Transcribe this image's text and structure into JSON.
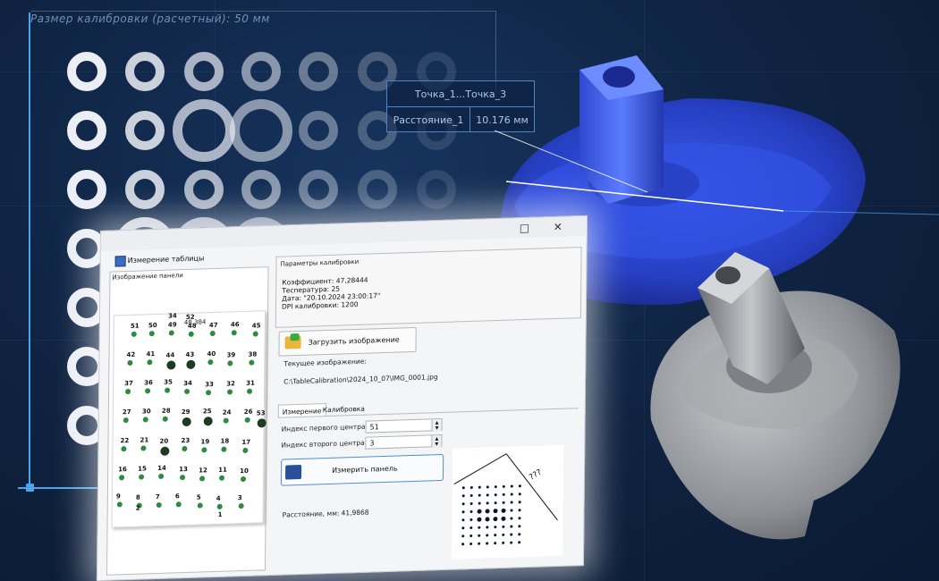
{
  "background": {
    "calibration_caption": "Размер калибровки (расчетный): 50 мм",
    "accent_color": "#4aa6e8"
  },
  "measurement_overlay": {
    "header": "Точка_1...Точка_3",
    "label": "Расстояние_1",
    "value": "10.176 мм"
  },
  "window": {
    "title": "Измерение таблицы",
    "controls": {
      "maximize": "□",
      "close": "✕"
    },
    "left_group": {
      "label": "Изображение панели",
      "overlay_value": "48.384",
      "dot_labels": [
        "34",
        "52",
        "51",
        "50",
        "49",
        "48",
        "47",
        "46",
        "45",
        "42",
        "41",
        "44",
        "43",
        "40",
        "39",
        "38",
        "37",
        "36",
        "35",
        "34",
        "33",
        "32",
        "31",
        "27",
        "30",
        "28",
        "29",
        "25",
        "24",
        "26",
        "53",
        "22",
        "21",
        "20",
        "23",
        "19",
        "18",
        "17",
        "16",
        "15",
        "14",
        "13",
        "12",
        "11",
        "10",
        "9",
        "8",
        "7",
        "6",
        "5",
        "4",
        "3",
        "2",
        "1"
      ]
    },
    "calibration": {
      "label": "Параметры калибровки",
      "lines": [
        "Коэффициент: 47,28444",
        "Теспература: 25",
        "Дата: \"20.10.2024 23:00:17\"",
        "DPI калибровки: 1200"
      ]
    },
    "load_button": "Загрузить изображение",
    "current_image_label": "Текущее изображение:",
    "current_image_path": "C:\\TableCalibration\\2024_10_07\\IMG_0001.jpg",
    "tabs": [
      {
        "label": "Измерение",
        "active": true
      },
      {
        "label": "Калибровка",
        "active": false
      }
    ],
    "measurement": {
      "first_center_label": "Индекс первого центра:",
      "first_center_value": "51",
      "second_center_label": "Индекс второго центра:",
      "second_center_value": "3",
      "measure_button": "Измерить панель",
      "distance_label": "Расстояние, мм:",
      "distance_value": "41,9868",
      "diagram_label": "???"
    }
  }
}
